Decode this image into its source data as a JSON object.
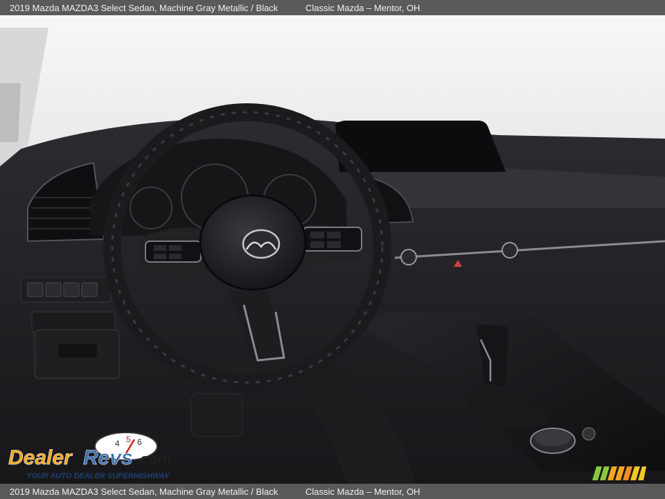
{
  "caption": {
    "vehicle": "2019 Mazda MAZDA3 Select Sedan,  Machine Gray Metallic / Black",
    "dealer": "Classic Mazda – Mentor, OH"
  },
  "watermark": {
    "brand": "DealerRevs.com",
    "tagline": "YOUR AUTO DEALER SUPERHIGHWAY",
    "brand_colors": {
      "dealer": "#f2a623",
      "revs": "#3a6fb0",
      "com": "#1f1f1f"
    }
  },
  "photo": {
    "subject": "dashboard-interior",
    "icons": [
      "steering-wheel-icon",
      "mazda-logo-icon",
      "gear-shifter-icon"
    ]
  }
}
